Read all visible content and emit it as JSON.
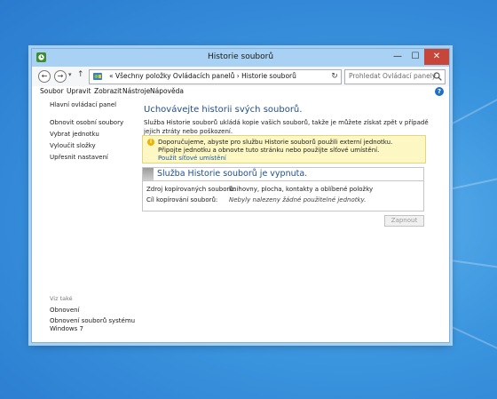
{
  "window": {
    "title": "Historie souborů",
    "minimize": "—",
    "maximize": "☐",
    "close": "✕"
  },
  "nav": {
    "back": "←",
    "forward": "→",
    "dropdown": "▾",
    "up": "↑",
    "breadcrumb": "«  Všechny položky Ovládacích panelů  ›  Historie souborů",
    "refresh": "↻",
    "search_placeholder": "Prohledat Ovládací panely"
  },
  "menu": [
    "Soubor",
    "Upravit",
    "Zobrazit",
    "Nástroje",
    "Nápověda"
  ],
  "help": "?",
  "sidebar": {
    "home": "Hlavní ovládací panel",
    "links": [
      "Obnovit osobní soubory",
      "Vybrat jednotku",
      "Vyloučit složky",
      "Upřesnit nastavení"
    ],
    "see_also_label": "Viz také",
    "see_also": [
      "Obnovení",
      "Obnovení souborů systému",
      "Windows 7"
    ]
  },
  "main": {
    "title": "Uchovávejte historii svých souborů.",
    "description": "Služba Historie souborů ukládá kopie vašich souborů, takže je můžete získat zpět v případě jejich ztráty nebo poškození.",
    "warning": "Doporučujeme, abyste pro službu Historie souborů použili externí jednotku. Připojte jednotku a obnovte tuto stránku nebo použijte síťové umístění.",
    "warning_link": "Použít síťové umístění",
    "status_title": "Služba Historie souborů je vypnuta.",
    "source_label": "Zdroj kopírovaných souborů:",
    "source_value": "knihovny, plocha, kontakty a oblíbené položky",
    "target_label": "Cíl kopírování souborů:",
    "target_value": "Nebyly nalezeny žádné použitelné jednotky.",
    "enable_button": "Zapnout"
  }
}
